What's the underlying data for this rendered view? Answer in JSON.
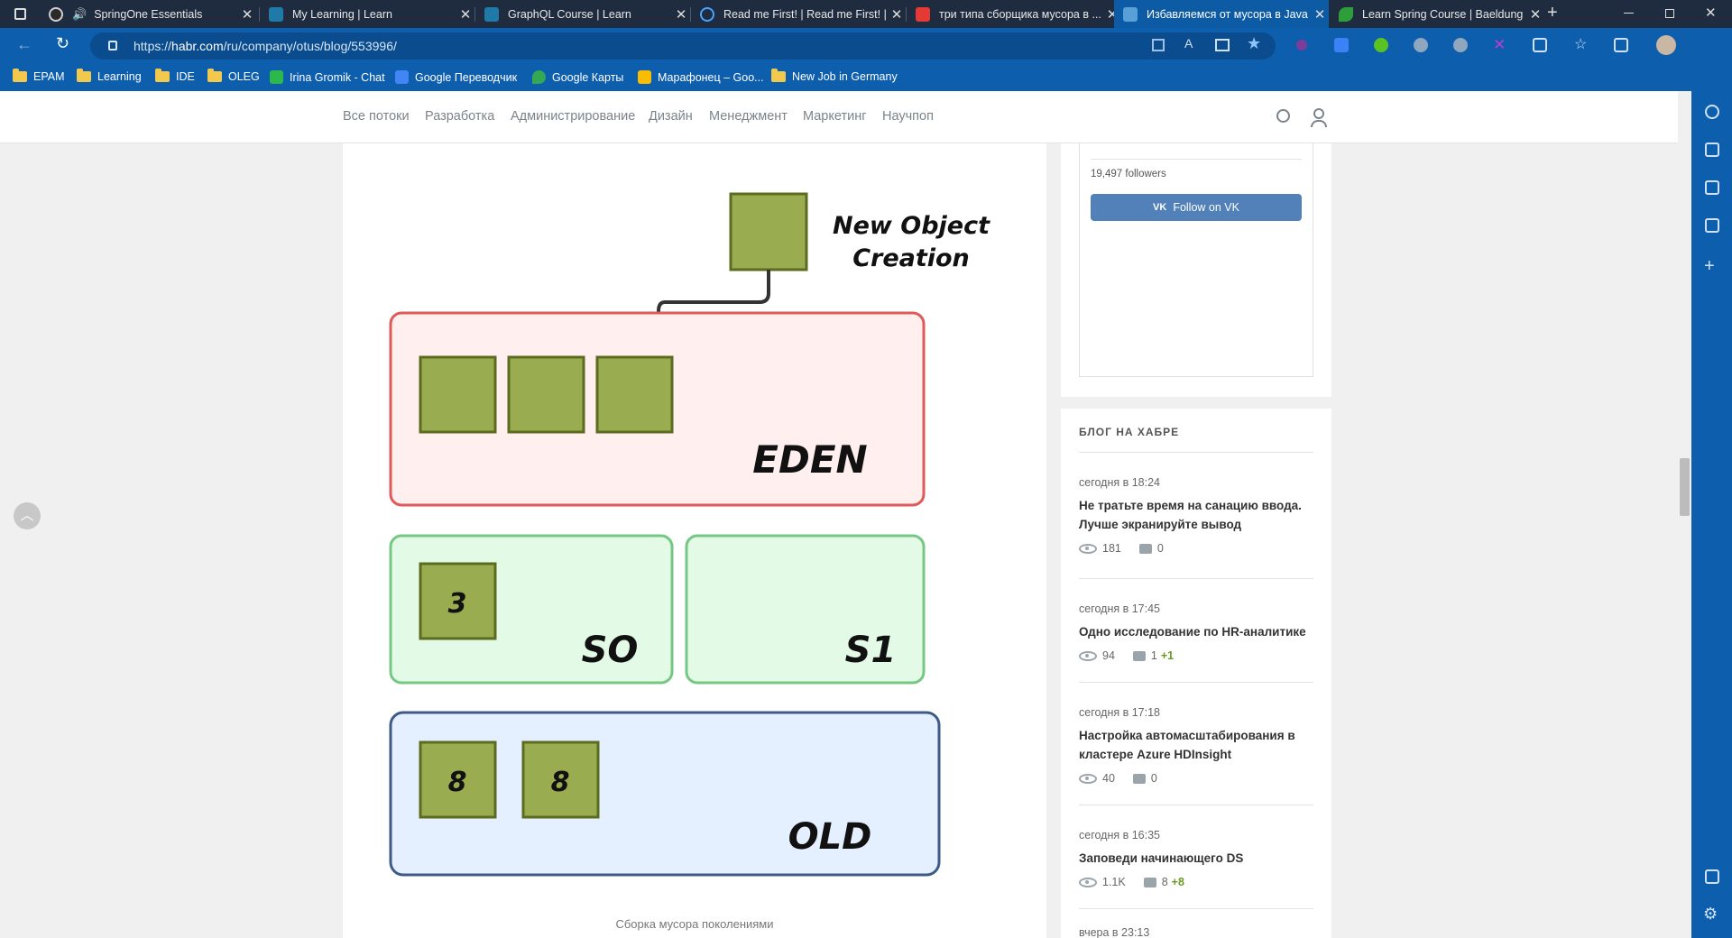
{
  "browser": {
    "tabs": [
      {
        "title": "SpringOne Essentials",
        "color": "#2a2a2a"
      },
      {
        "title": "My Learning | Learn",
        "color": "#1f7aa8"
      },
      {
        "title": "GraphQL Course | Learn",
        "color": "#1f7aa8"
      },
      {
        "title": "Read me First! | Read me First! | ...",
        "color": "#1f2c3f"
      },
      {
        "title": "три типа сборщика мусора в ...",
        "color": "#e53935"
      },
      {
        "title": "Избавляемся от мусора в Java",
        "color": "#5aa0d8"
      },
      {
        "title": "Learn Spring Course | Baeldung",
        "color": "#2e9e3a"
      }
    ],
    "url_prefix": "https://",
    "url_host": "habr.com",
    "url_path": "/ru/company/otus/blog/553996/",
    "bookmarks": [
      "EPAM",
      "Learning",
      "IDE",
      "OLEG",
      "Irina Gromik - Chat",
      "Google Переводчик",
      "Google Карты",
      "Марафонец – Goo...",
      "New Job in Germany"
    ]
  },
  "nav": {
    "items": [
      "Все потоки",
      "Разработка",
      "Администрирование",
      "Дизайн",
      "Менеджмент",
      "Маркетинг",
      "Научпоп"
    ]
  },
  "diagram": {
    "new_object_line1": "New Object",
    "new_object_line2": "Creation",
    "eden_label": "EDEN",
    "s0_label": "SO",
    "s1_label": "S1",
    "old_label": "OLD",
    "s0_value": "3",
    "old_value_1": "8",
    "old_value_2": "8",
    "caption": "Сборка мусора поколениями"
  },
  "sidebar": {
    "followers": "19,497 followers",
    "follow_button": "Follow on VK",
    "blog_heading": "БЛОГ НА ХАБРЕ",
    "posts": [
      {
        "time": "сегодня в 18:24",
        "title": "Не тратьте время на санацию ввода. Лучше экранируйте вывод",
        "views": "181",
        "comments": "0",
        "new": ""
      },
      {
        "time": "сегодня в 17:45",
        "title": "Одно исследование по HR-аналитике",
        "views": "94",
        "comments": "1",
        "new": "+1"
      },
      {
        "time": "сегодня в 17:18",
        "title": "Настройка автомасштабирования в кластере Azure HDInsight",
        "views": "40",
        "comments": "0",
        "new": ""
      },
      {
        "time": "сегодня в 16:35",
        "title": "Заповеди начинающего DS",
        "views": "1.1K",
        "comments": "8",
        "new": "+8"
      },
      {
        "time": "вчера в 23:13",
        "title": "",
        "views": "",
        "comments": "",
        "new": ""
      }
    ]
  }
}
